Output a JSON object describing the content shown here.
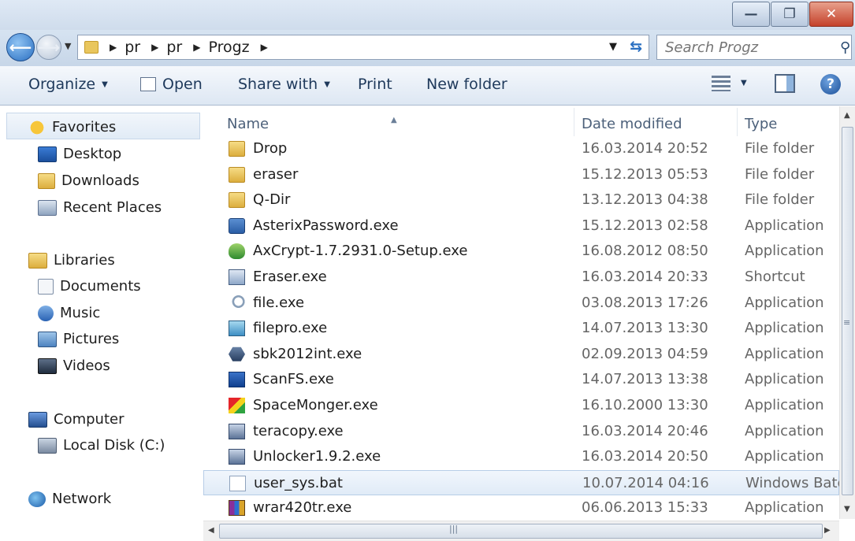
{
  "window": {
    "min_glyph": "—",
    "max_glyph": "❐",
    "close_glyph": "✕"
  },
  "address": {
    "breadcrumbs": [
      "pr",
      "pr",
      "Progz"
    ],
    "search_placeholder": "Search Progz"
  },
  "toolbar": {
    "organize": "Organize",
    "open": "Open",
    "share_with": "Share with",
    "print": "Print",
    "new_folder": "New folder"
  },
  "nav": {
    "favorites": "Favorites",
    "desktop": "Desktop",
    "downloads": "Downloads",
    "recent_places": "Recent Places",
    "libraries": "Libraries",
    "documents": "Documents",
    "music": "Music",
    "pictures": "Pictures",
    "videos": "Videos",
    "computer": "Computer",
    "local_disk": "Local Disk (C:)",
    "network": "Network"
  },
  "columns": {
    "name": "Name",
    "date_modified": "Date modified",
    "type": "Type"
  },
  "files": [
    {
      "name": "Drop",
      "date": "16.03.2014 20:52",
      "type": "File folder",
      "icon": "folder-icon"
    },
    {
      "name": "eraser",
      "date": "15.12.2013 05:53",
      "type": "File folder",
      "icon": "folder-icon"
    },
    {
      "name": "Q-Dir",
      "date": "13.12.2013 04:38",
      "type": "File folder",
      "icon": "folder-icon"
    },
    {
      "name": "AsterixPassword.exe",
      "date": "15.12.2013 02:58",
      "type": "Application",
      "icon": "app-icon"
    },
    {
      "name": "AxCrypt-1.7.2931.0-Setup.exe",
      "date": "16.08.2012 08:50",
      "type": "Application",
      "icon": "shield-icon"
    },
    {
      "name": "Eraser.exe",
      "date": "16.03.2014 20:33",
      "type": "Shortcut",
      "icon": "shortcut-icon"
    },
    {
      "name": "file.exe",
      "date": "03.08.2013 17:26",
      "type": "Application",
      "icon": "magnifier-icon"
    },
    {
      "name": "filepro.exe",
      "date": "14.07.2013 13:30",
      "type": "Application",
      "icon": "filepro-icon"
    },
    {
      "name": "sbk2012int.exe",
      "date": "02.09.2013 04:59",
      "type": "Application",
      "icon": "hexagon-icon"
    },
    {
      "name": "ScanFS.exe",
      "date": "14.07.2013 13:38",
      "type": "Application",
      "icon": "scan-icon"
    },
    {
      "name": "SpaceMonger.exe",
      "date": "16.10.2000 13:30",
      "type": "Application",
      "icon": "spacemonger-icon"
    },
    {
      "name": "teracopy.exe",
      "date": "16.03.2014 20:46",
      "type": "Application",
      "icon": "setup-icon"
    },
    {
      "name": "Unlocker1.9.2.exe",
      "date": "16.03.2014 20:50",
      "type": "Application",
      "icon": "setup-icon"
    },
    {
      "name": "user_sys.bat",
      "date": "10.07.2014 04:16",
      "type": "Windows Batc",
      "icon": "batch-file-icon",
      "selected": true
    },
    {
      "name": "wrar420tr.exe",
      "date": "06.06.2013 15:33",
      "type": "Application",
      "icon": "winrar-icon"
    }
  ]
}
